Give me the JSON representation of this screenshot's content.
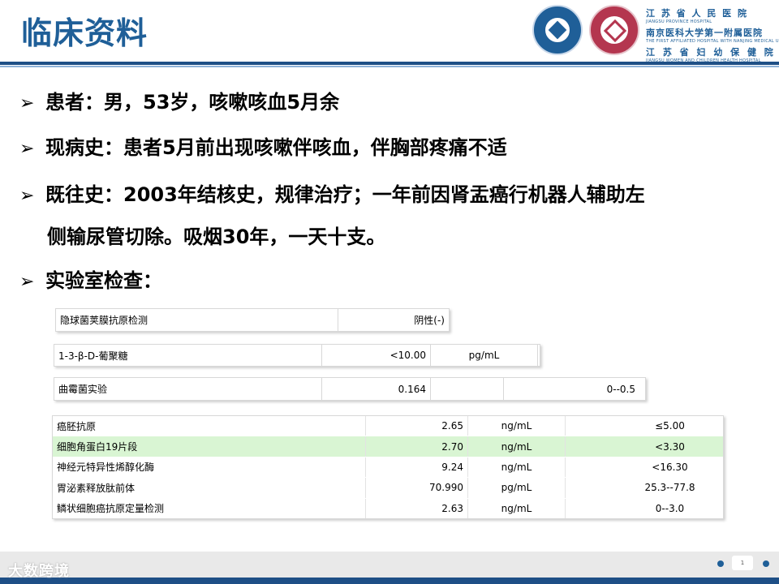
{
  "slide": {
    "title": "临床资料",
    "colors": {
      "title": "#1f5f98",
      "rule": "#1e4f86",
      "highlight_row": "#d9f5d3"
    }
  },
  "hospital": {
    "line1_cn": "江 苏 省 人 民 医 院",
    "line1_en": "JIANGSU PROVINCE HOSPITAL",
    "line2_cn": "南京医科大学第一附属医院",
    "line2_en": "THE FIRST AFFILIATED HOSPITAL WITH NANJING MEDICAL UNIVERSITY",
    "line3_cn": "江 苏 省 妇 幼 保 健 院",
    "line3_en": "JIANGSU WOMEN AND CHILDREN HEALTH HOSPITAL"
  },
  "bullets": [
    {
      "marker": "➢",
      "text": "患者：男，53岁，咳嗽咳血5月余"
    },
    {
      "marker": "➢",
      "text": "现病史：患者5月前出现咳嗽伴咳血，伴胸部疼痛不适"
    },
    {
      "marker": "➢",
      "text": "既往史：2003年结核史，规律治疗；一年前因肾盂癌行机器人辅助左",
      "continuation": "侧输尿管切除。吸烟30年，一天十支。"
    },
    {
      "marker": "➢",
      "text": "实验室检查："
    }
  ],
  "tests": {
    "crypto": {
      "name": "隐球菌荚膜抗原检测",
      "result": "阴性(-)"
    },
    "glucan": {
      "name": "1-3-β-D-葡聚糖",
      "value": "<10.00",
      "unit": "pg/mL"
    },
    "gm": {
      "name": "曲霉菌实验",
      "value": "0.164",
      "unit": "",
      "ref": "0--0.5"
    }
  },
  "tumor_markers": [
    {
      "name": "癌胚抗原",
      "value": "2.65",
      "unit": "ng/mL",
      "ref": "≤5.00",
      "highlight": false
    },
    {
      "name": "细胞角蛋白19片段",
      "value": "2.70",
      "unit": "ng/mL",
      "ref": "<3.30",
      "highlight": true
    },
    {
      "name": "神经元特异性烯醇化酶",
      "value": "9.24",
      "unit": "ng/mL",
      "ref": "<16.30",
      "highlight": false
    },
    {
      "name": "胃泌素释放肽前体",
      "value": "70.990",
      "unit": "pg/mL",
      "ref": "25.3--77.8",
      "highlight": false
    },
    {
      "name": "鳞状细胞癌抗原定量检测",
      "value": "2.63",
      "unit": "ng/mL",
      "ref": "0--3.0",
      "highlight": false
    }
  ],
  "footer": {
    "watermark": "大数跨境",
    "page_number": "1"
  }
}
